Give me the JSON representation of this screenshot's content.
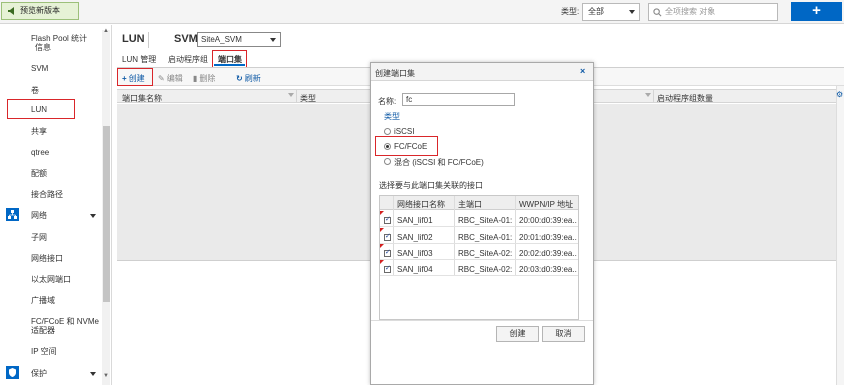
{
  "topbar": {
    "preview_label": "预览新版本",
    "type_label": "类型:",
    "type_value": "全部",
    "search_placeholder": "全项搜索 对象",
    "add_label": "+"
  },
  "sidebar": {
    "items": [
      {
        "label": "Flash Pool 统计"
      },
      {
        "label": "信息"
      },
      {
        "label": "SVM"
      },
      {
        "label": "卷"
      },
      {
        "label": "LUN"
      },
      {
        "label": "共享"
      },
      {
        "label": "qtree"
      },
      {
        "label": "配额"
      },
      {
        "label": "接合路径"
      },
      {
        "label": "网络"
      },
      {
        "label": "子网"
      },
      {
        "label": "网络接口"
      },
      {
        "label": "以太网端口"
      },
      {
        "label": "广播域"
      },
      {
        "label": "FC/FCoE 和 NVMe"
      },
      {
        "label": "适配器"
      },
      {
        "label": "IP 空间"
      },
      {
        "label": "保护"
      }
    ]
  },
  "header": {
    "title": "LUN",
    "svm_label": "SVM",
    "svm_value": "SiteA_SVM"
  },
  "tabs": [
    {
      "label": "LUN 管理"
    },
    {
      "label": "启动程序组"
    },
    {
      "label": "端口集"
    }
  ],
  "toolbar": {
    "create": "创建",
    "edit": "编辑",
    "delete": "删除",
    "refresh": "刷新"
  },
  "grid": {
    "columns": [
      "端口集名称",
      "类型",
      "启动程序组数量"
    ]
  },
  "modal": {
    "title": "创建端口集",
    "close": "×",
    "name_label": "名称:",
    "name_value": "fc",
    "type_heading": "类型",
    "options": [
      "iSCSI",
      "FC/FCoE",
      "混合 (iSCSI 和 FC/FCoE)"
    ],
    "selected_option": "FC/FCoE",
    "interface_heading": "选择要与此端口集关联的接口",
    "table": {
      "columns": [
        "网络接口名称",
        "主端口",
        "WWPN/IP 地址"
      ],
      "rows": [
        {
          "name": "SAN_lif01",
          "port": "RBC_SiteA-01:...",
          "addr": "20:00:d0:39:ea..."
        },
        {
          "name": "SAN_lif02",
          "port": "RBC_SiteA-01:...",
          "addr": "20:01:d0:39:ea..."
        },
        {
          "name": "SAN_lif03",
          "port": "RBC_SiteA-02:...",
          "addr": "20:02:d0:39:ea..."
        },
        {
          "name": "SAN_lif04",
          "port": "RBC_SiteA-02:...",
          "addr": "20:03:d0:39:ea..."
        }
      ]
    },
    "create_button": "创建",
    "cancel_button": "取消"
  },
  "colors": {
    "accent": "#0067c5",
    "highlight_box": "#d9262a"
  }
}
